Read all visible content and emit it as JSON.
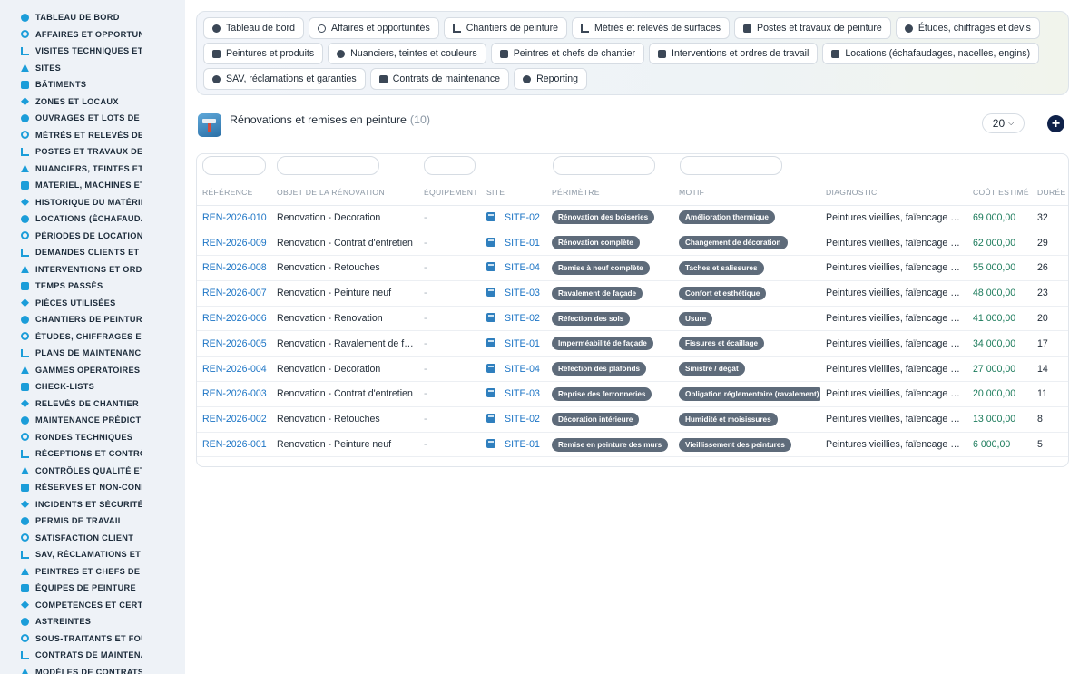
{
  "sidebar": {
    "items": [
      {
        "label": "TABLEAU DE BORD",
        "icon": "gauge-icon"
      },
      {
        "label": "AFFAIRES ET OPPORTUN",
        "icon": "target-icon"
      },
      {
        "label": "VISITES TECHNIQUES ET",
        "icon": "ruler-icon"
      },
      {
        "label": "SITES",
        "icon": "pin-icon"
      },
      {
        "label": "BÂTIMENTS",
        "icon": "building-icon"
      },
      {
        "label": "ZONES ET LOCAUX",
        "icon": "grid-icon"
      },
      {
        "label": "OUVRAGES ET LOTS DE T",
        "icon": "sitemap-icon"
      },
      {
        "label": "MÉTRÉS ET RELEVÉS DE",
        "icon": "ruler-icon"
      },
      {
        "label": "POSTES ET TRAVAUX DE",
        "icon": "paint-roller-icon"
      },
      {
        "label": "NUANCIERS, TEINTES ET",
        "icon": "palette-icon"
      },
      {
        "label": "MATÉRIEL, MACHINES ET",
        "icon": "cogs-icon"
      },
      {
        "label": "HISTORIQUE DU MATÉRIE",
        "icon": "history-icon"
      },
      {
        "label": "LOCATIONS (ÉCHAFAUDA",
        "icon": "truck-icon"
      },
      {
        "label": "PÉRIODES DE LOCATION",
        "icon": "calendar-icon"
      },
      {
        "label": "DEMANDES CLIENTS ET I",
        "icon": "question-icon"
      },
      {
        "label": "INTERVENTIONS ET ORDI",
        "icon": "clipboard-icon"
      },
      {
        "label": "TEMPS PASSÉS",
        "icon": "clock-icon"
      },
      {
        "label": "PIÈCES UTILISÉES",
        "icon": "box-icon"
      },
      {
        "label": "CHANTIERS DE PEINTURI",
        "icon": "brush-icon"
      },
      {
        "label": "ÉTUDES, CHIFFRAGES ET",
        "icon": "calculator-icon"
      },
      {
        "label": "PLANS DE MAINTENANCE",
        "icon": "calendar-icon"
      },
      {
        "label": "GAMMES OPÉRATOIRES",
        "icon": "list-icon"
      },
      {
        "label": "CHECK-LISTS",
        "icon": "checklist-icon"
      },
      {
        "label": "RELEVÉS DE CHANTIER",
        "icon": "thermometer-icon"
      },
      {
        "label": "MAINTENANCE PRÉDICTI",
        "icon": "chart-icon"
      },
      {
        "label": "RONDES TECHNIQUES",
        "icon": "route-icon"
      },
      {
        "label": "RÉCEPTIONS ET CONTRÔ",
        "icon": "search-icon"
      },
      {
        "label": "CONTRÔLES QUALITÉ ET",
        "icon": "clipboard-check-icon"
      },
      {
        "label": "RÉSERVES ET NON-CONF",
        "icon": "alert-icon"
      },
      {
        "label": "INCIDENTS ET SÉCURITÉ",
        "icon": "warning-icon"
      },
      {
        "label": "PERMIS DE TRAVAIL",
        "icon": "file-signature-icon"
      },
      {
        "label": "SATISFACTION CLIENT",
        "icon": "smile-icon"
      },
      {
        "label": "SAV, RÉCLAMATIONS ET",
        "icon": "comment-icon"
      },
      {
        "label": "PEINTRES ET CHEFS DE",
        "icon": "hardhat-icon"
      },
      {
        "label": "ÉQUIPES DE PEINTURE",
        "icon": "users-icon"
      },
      {
        "label": "COMPÉTENCES ET CERTI",
        "icon": "certificate-icon"
      },
      {
        "label": "ASTREINTES",
        "icon": "phone-icon"
      },
      {
        "label": "SOUS-TRAITANTS ET FOU",
        "icon": "handshake-icon"
      },
      {
        "label": "CONTRATS DE MAINTENA",
        "icon": "file-icon"
      },
      {
        "label": "MODÈLES DE CONTRATS",
        "icon": "file-icon"
      }
    ]
  },
  "tabs": [
    {
      "label": "Tableau de bord",
      "icon": "gauge-icon"
    },
    {
      "label": "Affaires et opportunités",
      "icon": "target-icon"
    },
    {
      "label": "Chantiers de peinture",
      "icon": "brush-icon"
    },
    {
      "label": "Métrés et relevés de surfaces",
      "icon": "ruler-icon"
    },
    {
      "label": "Postes et travaux de peinture",
      "icon": "paint-roller-icon"
    },
    {
      "label": "Études, chiffrages et devis",
      "icon": "calculator-icon"
    },
    {
      "label": "Peintures et produits",
      "icon": "fill-icon"
    },
    {
      "label": "Nuanciers, teintes et couleurs",
      "icon": "palette-icon"
    },
    {
      "label": "Peintres et chefs de chantier",
      "icon": "hardhat-icon"
    },
    {
      "label": "Interventions et ordres de travail",
      "icon": "clipboard-icon"
    },
    {
      "label": "Locations (échafaudages, nacelles, engins)",
      "icon": "truck-icon"
    },
    {
      "label": "SAV, réclamations et garanties",
      "icon": "comment-icon"
    },
    {
      "label": "Contrats de maintenance",
      "icon": "file-icon"
    },
    {
      "label": "Reporting",
      "icon": "chart-pie-icon"
    }
  ],
  "header": {
    "title": "Rénovations et remises en peinture",
    "count": "(10)",
    "page_size": "20",
    "add_label": "+"
  },
  "table": {
    "columns": [
      "RÉFÉRENCE",
      "OBJET DE LA RÉNOVATION",
      "ÉQUIPEMENT",
      "SITE",
      "PÉRIMÈTRE",
      "MOTIF",
      "DIAGNOSTIC",
      "COÛT ESTIMÉ",
      "DURÉE"
    ],
    "rows": [
      {
        "ref": "REN-2026-010",
        "objet": "Renovation - Decoration",
        "equipement": "-",
        "site": "SITE-02",
        "perimetre": "Rénovation des boiseries",
        "motif": "Amélioration thermique",
        "diagnostic": "Peintures vieillies, faïencage …",
        "cout": "69 000,00",
        "duree": "32"
      },
      {
        "ref": "REN-2026-009",
        "objet": "Renovation - Contrat d'entretien",
        "equipement": "-",
        "site": "SITE-01",
        "perimetre": "Rénovation complète",
        "motif": "Changement de décoration",
        "diagnostic": "Peintures vieillies, faïencage …",
        "cout": "62 000,00",
        "duree": "29"
      },
      {
        "ref": "REN-2026-008",
        "objet": "Renovation - Retouches",
        "equipement": "-",
        "site": "SITE-04",
        "perimetre": "Remise à neuf complète",
        "motif": "Taches et salissures",
        "diagnostic": "Peintures vieillies, faïencage …",
        "cout": "55 000,00",
        "duree": "26"
      },
      {
        "ref": "REN-2026-007",
        "objet": "Renovation - Peinture neuf",
        "equipement": "-",
        "site": "SITE-03",
        "perimetre": "Ravalement de façade",
        "motif": "Confort et esthétique",
        "diagnostic": "Peintures vieillies, faïencage …",
        "cout": "48 000,00",
        "duree": "23"
      },
      {
        "ref": "REN-2026-006",
        "objet": "Renovation - Renovation",
        "equipement": "-",
        "site": "SITE-02",
        "perimetre": "Réfection des sols",
        "motif": "Usure",
        "diagnostic": "Peintures vieillies, faïencage …",
        "cout": "41 000,00",
        "duree": "20"
      },
      {
        "ref": "REN-2026-005",
        "objet": "Renovation - Ravalement de f…",
        "equipement": "-",
        "site": "SITE-01",
        "perimetre": "Imperméabilité de façade",
        "motif": "Fissures et écaillage",
        "diagnostic": "Peintures vieillies, faïencage …",
        "cout": "34 000,00",
        "duree": "17"
      },
      {
        "ref": "REN-2026-004",
        "objet": "Renovation - Decoration",
        "equipement": "-",
        "site": "SITE-04",
        "perimetre": "Réfection des plafonds",
        "motif": "Sinistre / dégât",
        "diagnostic": "Peintures vieillies, faïencage …",
        "cout": "27 000,00",
        "duree": "14"
      },
      {
        "ref": "REN-2026-003",
        "objet": "Renovation - Contrat d'entretien",
        "equipement": "-",
        "site": "SITE-03",
        "perimetre": "Reprise des ferronneries",
        "motif": "Obligation réglementaire (ravalement)",
        "diagnostic": "Peintures vieillies, faïencage …",
        "cout": "20 000,00",
        "duree": "11"
      },
      {
        "ref": "REN-2026-002",
        "objet": "Renovation - Retouches",
        "equipement": "-",
        "site": "SITE-02",
        "perimetre": "Décoration intérieure",
        "motif": "Humidité et moisissures",
        "diagnostic": "Peintures vieillies, faïencage …",
        "cout": "13 000,00",
        "duree": "8"
      },
      {
        "ref": "REN-2026-001",
        "objet": "Renovation - Peinture neuf",
        "equipement": "-",
        "site": "SITE-01",
        "perimetre": "Remise en peinture des murs",
        "motif": "Vieillissement des peintures",
        "diagnostic": "Peintures vieillies, faïencage …",
        "cout": "6 000,00",
        "duree": "5"
      }
    ]
  }
}
